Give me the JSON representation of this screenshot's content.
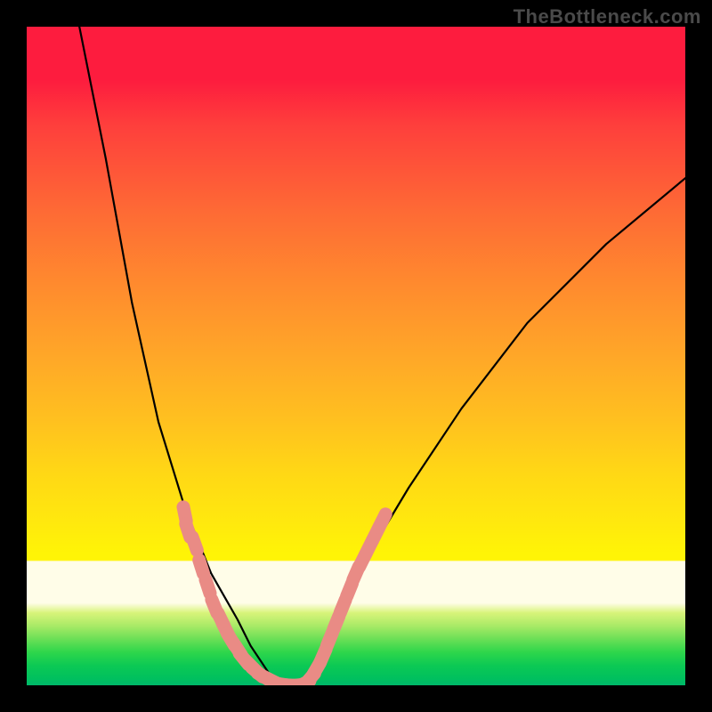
{
  "watermark": "TheBottleneck.com",
  "chart_data": {
    "type": "line",
    "title": "",
    "xlabel": "",
    "ylabel": "",
    "xlim": [
      0,
      100
    ],
    "ylim": [
      0,
      100
    ],
    "gradient_bands_top_to_bottom": [
      "red",
      "orange",
      "yellow",
      "pale-yellow",
      "green"
    ],
    "series": [
      {
        "name": "left-curve",
        "x": [
          8,
          12,
          16,
          20,
          24,
          28,
          32,
          34,
          36,
          38
        ],
        "y": [
          100,
          80,
          58,
          40,
          27,
          17,
          10,
          6,
          3,
          0
        ]
      },
      {
        "name": "right-curve",
        "x": [
          42,
          44,
          46,
          48,
          52,
          58,
          66,
          76,
          88,
          100
        ],
        "y": [
          0,
          3,
          7,
          12,
          20,
          30,
          42,
          55,
          67,
          77
        ]
      }
    ],
    "markers": {
      "name": "pink-beads",
      "description": "salmon-pink rounded dash markers along lower portions of both curves",
      "approx_points": [
        [
          24.0,
          26.0
        ],
        [
          24.5,
          23.5
        ],
        [
          25.5,
          21.5
        ],
        [
          26.5,
          18.0
        ],
        [
          27.5,
          15.0
        ],
        [
          28.5,
          12.0
        ],
        [
          29.5,
          10.0
        ],
        [
          30.2,
          8.5
        ],
        [
          31.0,
          7.0
        ],
        [
          32.0,
          5.5
        ],
        [
          33.0,
          4.0
        ],
        [
          34.0,
          3.0
        ],
        [
          35.0,
          2.0
        ],
        [
          36.0,
          1.3
        ],
        [
          37.0,
          0.8
        ],
        [
          38.0,
          0.3
        ],
        [
          39.0,
          0.1
        ],
        [
          40.0,
          0.0
        ],
        [
          41.0,
          0.0
        ],
        [
          42.0,
          0.2
        ],
        [
          43.0,
          1.0
        ],
        [
          44.0,
          2.5
        ],
        [
          45.0,
          4.5
        ],
        [
          46.0,
          7.0
        ],
        [
          47.0,
          9.5
        ],
        [
          48.0,
          12.0
        ],
        [
          49.0,
          14.5
        ],
        [
          50.0,
          17.0
        ],
        [
          51.0,
          19.0
        ],
        [
          52.0,
          21.0
        ],
        [
          53.0,
          23.0
        ],
        [
          54.0,
          25.0
        ]
      ]
    }
  }
}
